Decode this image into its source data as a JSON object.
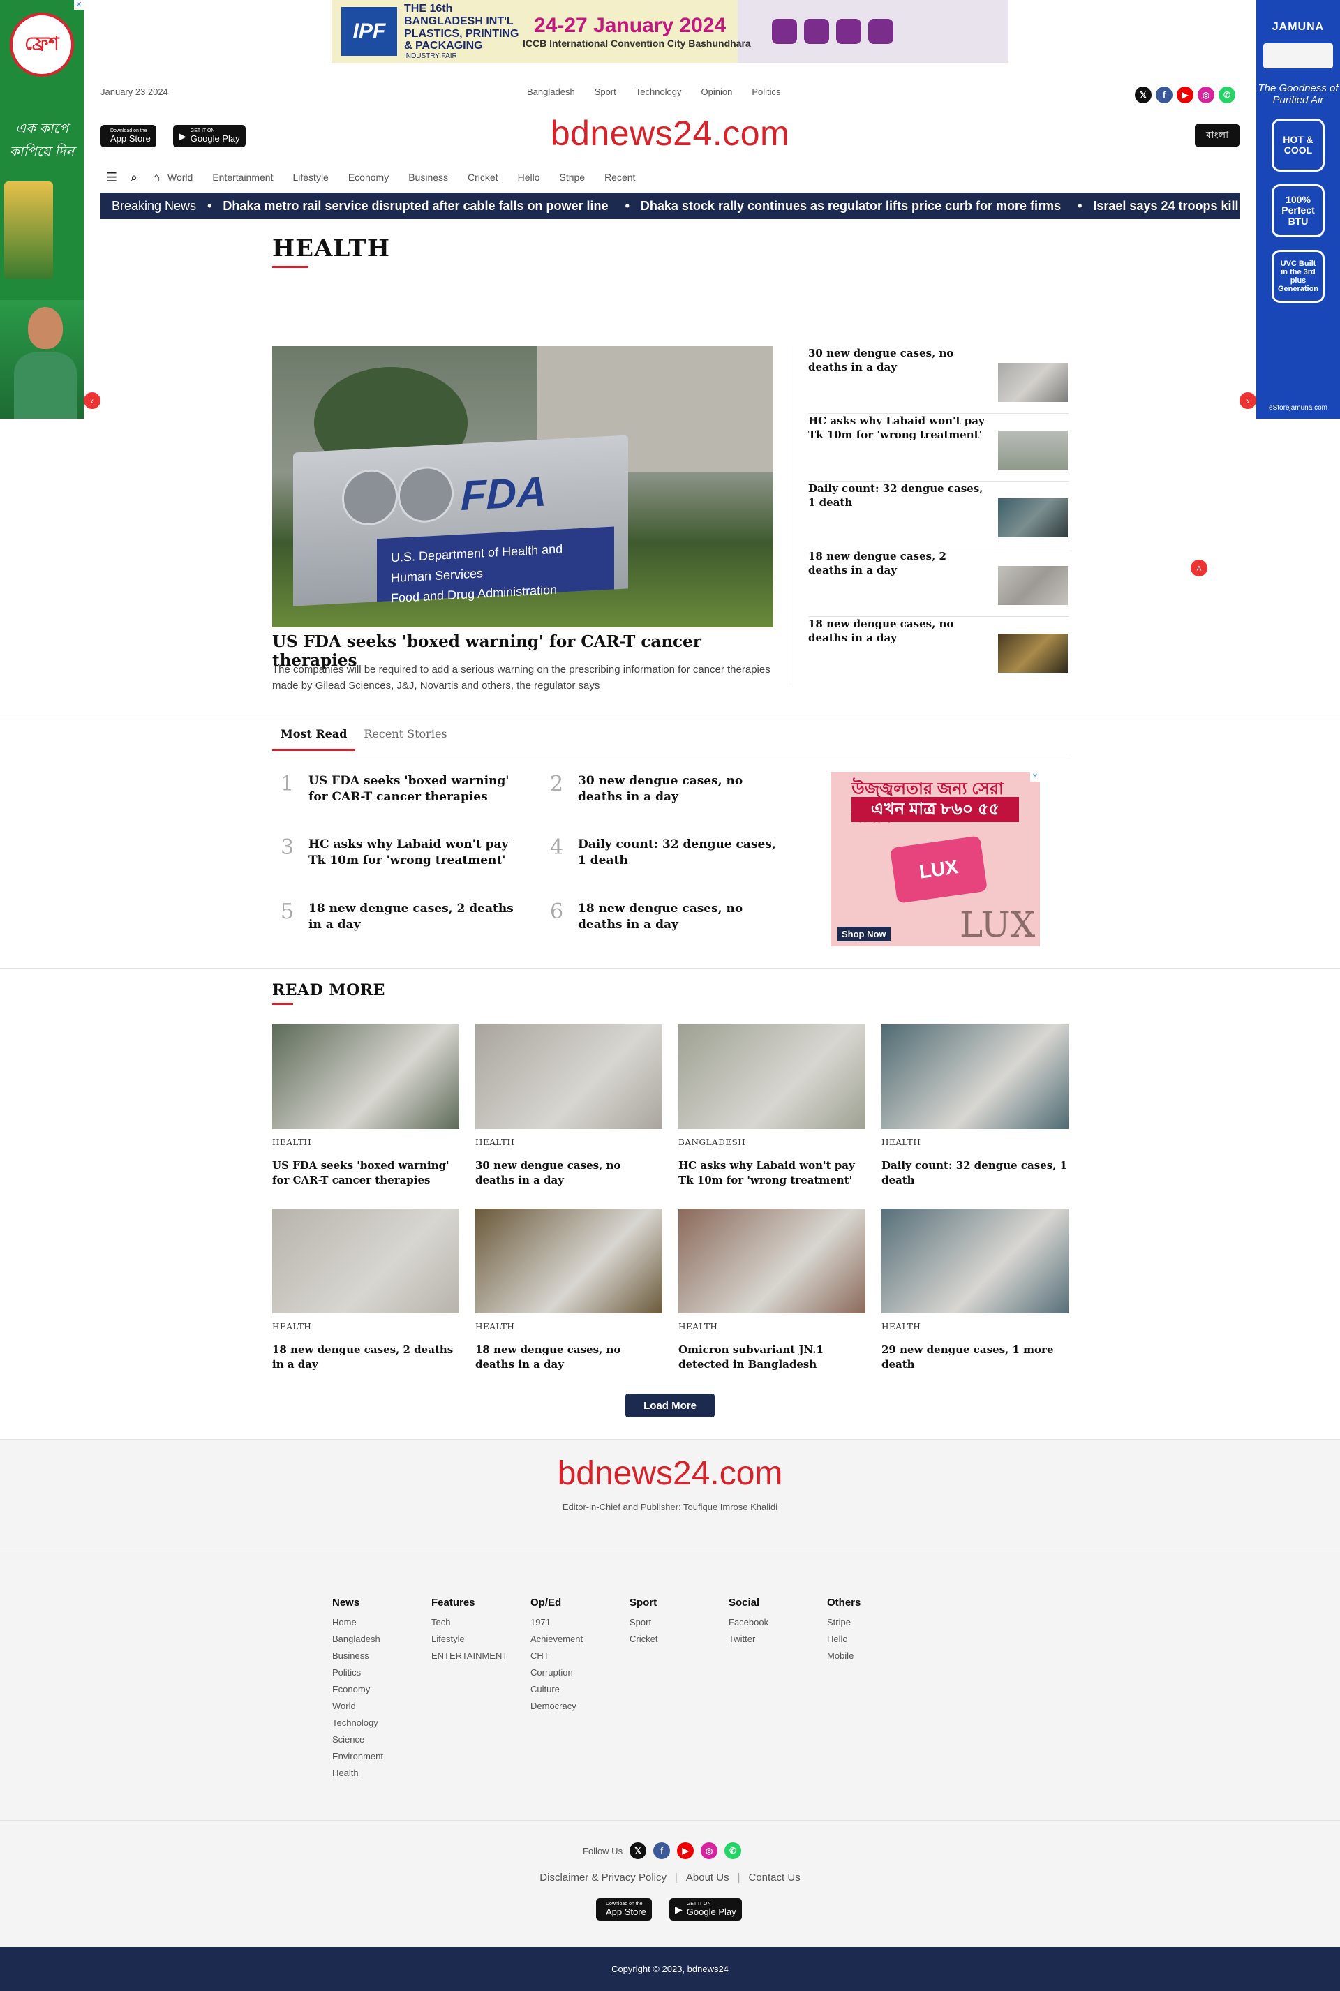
{
  "ads": {
    "left": {
      "logo_text": "ফ্রেশ",
      "tagline": "এক কাপে কাপিয়ে দিন"
    },
    "right": {
      "brand": "JAMUNA",
      "slogan": "The Goodness of Purified Air",
      "features": [
        "HOT & COOL",
        "100% Perfect BTU",
        "UVC Built in the 3rd plus Generation"
      ],
      "store": "eStorejamuna.com"
    },
    "top": {
      "logo": "IPF",
      "title": "THE 16th BANGLADESH INT'L PLASTICS, PRINTING & PACKAGING",
      "subtitle": "INDUSTRY FAIR",
      "dates": "24-27 January 2024",
      "venue": "ICCB International Convention City Bashundhara"
    },
    "lux": {
      "line1": "উজ্জ্বলতার জন্য সেরা সাবান",
      "line2": "এখন মাত্র ৮৬০ ৫৫",
      "product": "LUX",
      "brand": "LUX",
      "cta": "Shop Now"
    }
  },
  "header": {
    "date": "January 23 2024",
    "top_nav": [
      "Bangladesh",
      "Sport",
      "Technology",
      "Opinion",
      "Politics"
    ],
    "logo": "bdnews24.com",
    "lang": "বাংলা",
    "app_store": {
      "small": "Download on the",
      "label": "App Store"
    },
    "google_play": {
      "small": "GET IT ON",
      "label": "Google Play"
    }
  },
  "main_nav": [
    "World",
    "Entertainment",
    "Lifestyle",
    "Economy",
    "Business",
    "Cricket",
    "Hello",
    "Stripe",
    "Recent"
  ],
  "breaking": {
    "label": "Breaking News",
    "items": [
      "Dhaka metro rail service disrupted after cable falls on power line",
      "Dhaka stock rally continues as regulator lifts price curb for more firms",
      "Israel says 24 troops kill"
    ]
  },
  "section": {
    "title": "HEALTH"
  },
  "lead": {
    "title": "US FDA seeks 'boxed warning' for CAR-T cancer therapies",
    "summary": "The companies will be required to add a serious warning on the prescribing information for cancer therapies made by Gilead Sciences, J&J, Novartis and others, the regulator says",
    "image_text": {
      "logo": "FDA",
      "line1": "U.S. Department of Health and Human Services",
      "line2": "Food and Drug Administration"
    }
  },
  "side_stories": [
    "30 new dengue cases, no deaths in a day",
    "HC asks why Labaid won't pay Tk 10m for 'wrong treatment'",
    "Daily count: 32 dengue cases, 1 death",
    "18 new dengue cases, 2 deaths in a day",
    "18 new dengue cases, no deaths in a day"
  ],
  "tabs": {
    "most_read": "Most Read",
    "recent": "Recent Stories"
  },
  "most_read": [
    {
      "num": "1",
      "title": "US FDA seeks 'boxed warning' for CAR-T cancer therapies"
    },
    {
      "num": "2",
      "title": "30 new dengue cases, no deaths in a day"
    },
    {
      "num": "3",
      "title": "HC asks why Labaid won't pay Tk 10m for 'wrong treatment'"
    },
    {
      "num": "4",
      "title": "Daily count: 32 dengue cases, 1 death"
    },
    {
      "num": "5",
      "title": "18 new dengue cases, 2 deaths in a day"
    },
    {
      "num": "6",
      "title": "18 new dengue cases, no deaths in a day"
    }
  ],
  "read_more": {
    "title": "READ MORE",
    "cards": [
      {
        "cat": "HEALTH",
        "title": "US FDA seeks 'boxed warning' for CAR-T cancer therapies",
        "color": "#5d6b58"
      },
      {
        "cat": "HEALTH",
        "title": "30 new dengue cases, no deaths in a day",
        "color": "#a9a59e"
      },
      {
        "cat": "BANGLADESH",
        "title": "HC asks why Labaid won't pay Tk 10m for 'wrong treatment'",
        "color": "#9ea193"
      },
      {
        "cat": "HEALTH",
        "title": "Daily count: 32 dengue cases, 1 death",
        "color": "#4f6b73"
      },
      {
        "cat": "HEALTH",
        "title": "18 new dengue cases, 2 deaths in a day",
        "color": "#b7b3ac"
      },
      {
        "cat": "HEALTH",
        "title": "18 new dengue cases, no deaths in a day",
        "color": "#6b5a3a"
      },
      {
        "cat": "HEALTH",
        "title": "Omicron subvariant JN.1 detected in Bangladesh",
        "color": "#8b6a5a"
      },
      {
        "cat": "HEALTH",
        "title": "29 new dengue cases, 1 more death",
        "color": "#57707a"
      }
    ],
    "load_more": "Load More"
  },
  "footer": {
    "logo": "bdnews24.com",
    "editor": "Editor-in-Chief and Publisher: Toufique Imrose Khalidi",
    "columns": [
      {
        "heading": "News",
        "links": [
          "Home",
          "Bangladesh",
          "Business",
          "Politics",
          "Economy",
          "World",
          "Technology",
          "Science",
          "Environment",
          "Health"
        ]
      },
      {
        "heading": "Features",
        "links": [
          "Tech",
          "Lifestyle",
          "ENTERTAINMENT"
        ]
      },
      {
        "heading": "Op/Ed",
        "links": [
          "1971",
          "Achievement",
          "CHT",
          "Corruption",
          "Culture",
          "Democracy"
        ]
      },
      {
        "heading": "Sport",
        "links": [
          "Sport",
          "Cricket"
        ]
      },
      {
        "heading": "Social",
        "links": [
          "Facebook",
          "Twitter"
        ]
      },
      {
        "heading": "Others",
        "links": [
          "Stripe",
          "Hello",
          "Mobile"
        ]
      }
    ],
    "follow": "Follow Us",
    "links": [
      "Disclaimer & Privacy Policy",
      "About Us",
      "Contact Us"
    ],
    "copyright": "Copyright © 2023, bdnews24"
  },
  "colors": {
    "brand_red": "#d82128",
    "navy": "#1d2a4f"
  }
}
